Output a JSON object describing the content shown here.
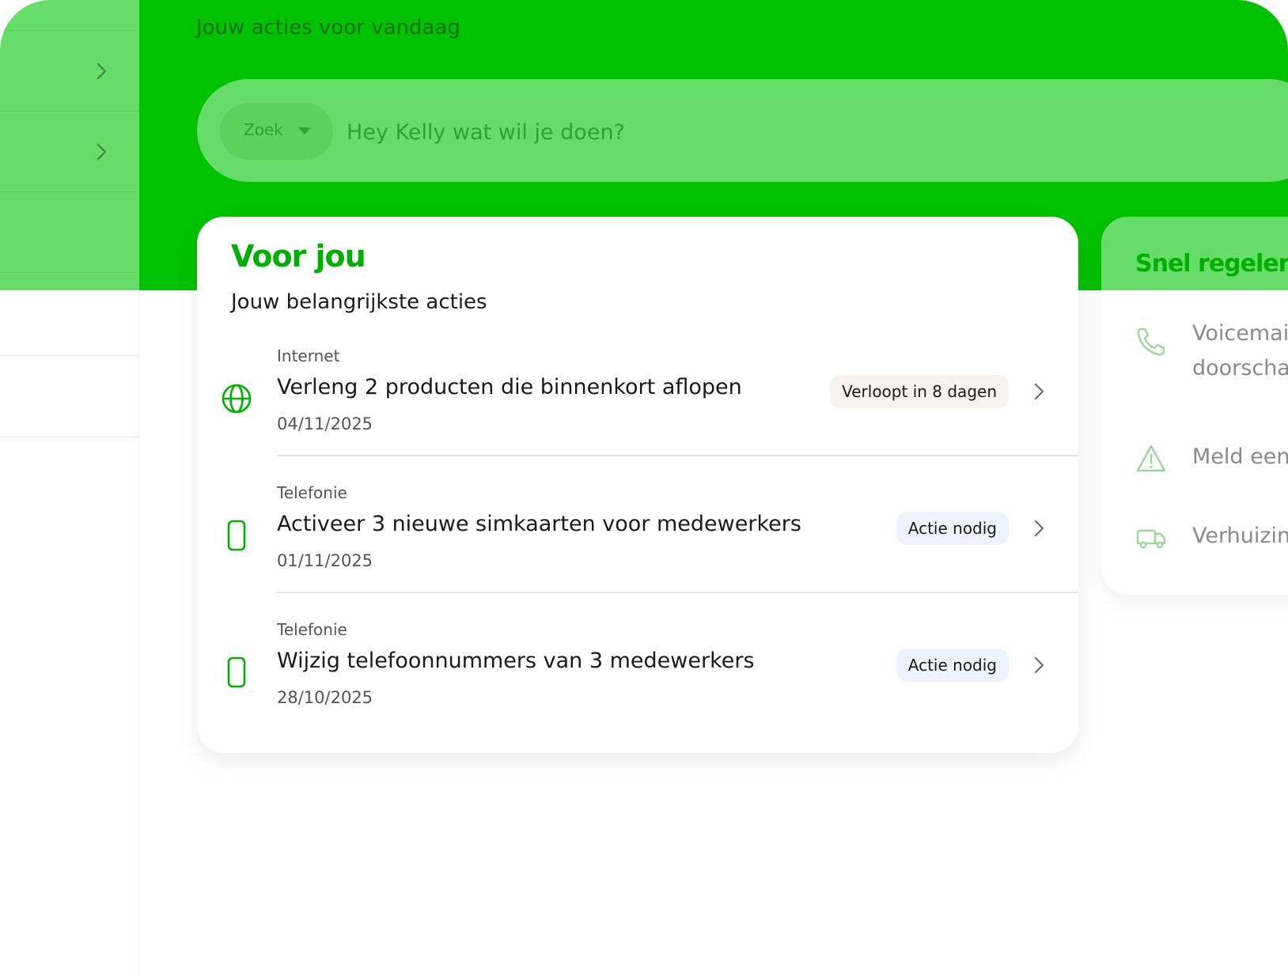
{
  "header": {
    "greeting": "Jouw acties voor vandaag"
  },
  "search": {
    "select_label": "Zoek",
    "placeholder": "Hey Kelly wat wil je doen?"
  },
  "for_you": {
    "title": "Voor jou",
    "subtitle": "Jouw belangrijkste acties",
    "items": [
      {
        "category": "Internet",
        "title": "Verleng 2 producten die binnenkort aflopen",
        "date": "04/11/2025",
        "badge": "Verloopt in 8 dagen",
        "icon": "globe-icon"
      },
      {
        "category": "Telefonie",
        "title": "Activeer 3 nieuwe simkaarten voor medewerkers",
        "date": "01/11/2025",
        "badge": "Actie nodig",
        "icon": "phone-icon"
      },
      {
        "category": "Telefonie",
        "title": "Wijzig telefoonnummers van 3 medewerkers",
        "date": "28/10/2025",
        "badge": "Actie nodig",
        "icon": "phone-icon"
      }
    ]
  },
  "quick": {
    "title": "Snel regelen",
    "items": [
      {
        "line1": "Voicemail",
        "line2": "doorschakelen",
        "icon": "handset-icon"
      },
      {
        "line1": "Meld een",
        "icon": "warning-icon"
      },
      {
        "line1": "Verhuizing",
        "icon": "truck-icon"
      }
    ]
  },
  "colors": {
    "brand_green": "#00c200",
    "light_green": "#67dd69",
    "title_green": "#00b000"
  }
}
